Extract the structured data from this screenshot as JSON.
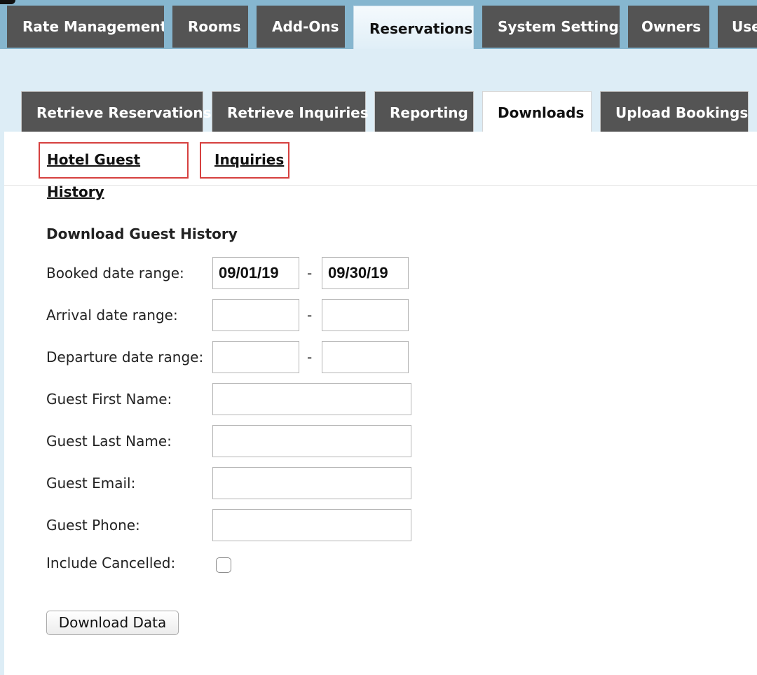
{
  "main_nav": {
    "tabs": [
      "Rate Management",
      "Rooms",
      "Add-Ons",
      "Reservations",
      "System Settings",
      "Owners",
      "Use"
    ],
    "active": "Reservations"
  },
  "sub_nav": {
    "tabs": [
      "Retrieve Reservations",
      "Retrieve Inquiries",
      "Reporting",
      "Downloads",
      "Upload Bookings"
    ],
    "active": "Downloads"
  },
  "download_links": [
    "Hotel Guest History",
    "Inquiries"
  ],
  "form": {
    "heading": "Download Guest History",
    "booked_label": "Booked date range:",
    "booked_from": "09/01/19",
    "booked_to": "09/30/19",
    "arrival_label": "Arrival date range:",
    "arrival_from": "",
    "arrival_to": "",
    "departure_label": "Departure date range:",
    "departure_from": "",
    "departure_to": "",
    "first_name_label": "Guest First Name:",
    "first_name": "",
    "last_name_label": "Guest Last Name:",
    "last_name": "",
    "email_label": "Guest Email:",
    "email": "",
    "phone_label": "Guest Phone:",
    "phone": "",
    "cancelled_label": "Include Cancelled:",
    "include_cancelled": false,
    "separator": "-",
    "submit_label": "Download Data"
  },
  "colors": {
    "tab_bg": "#545454",
    "nav_bar": "#86b6cf",
    "page_bg": "#ddedf6",
    "highlight_border": "#d6403f"
  }
}
